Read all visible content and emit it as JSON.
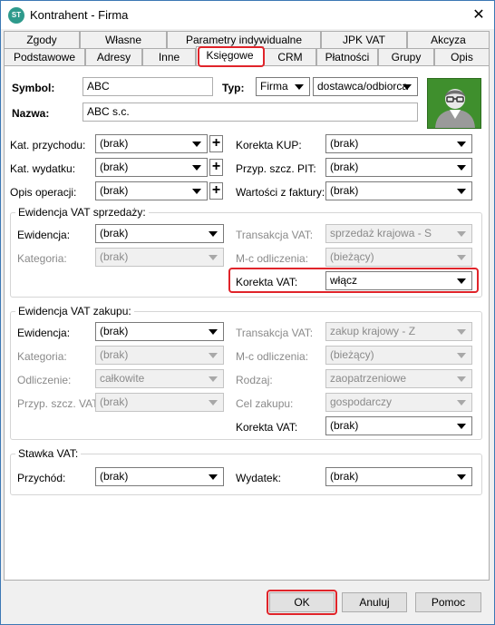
{
  "window": {
    "title": "Kontrahent - Firma",
    "close_glyph": "✕",
    "app_icon_text": "ST"
  },
  "tabs_row1": [
    "Zgody",
    "Własne",
    "Parametry indywidualne",
    "JPK VAT",
    "Akcyza"
  ],
  "tabs_row2": [
    "Podstawowe",
    "Adresy",
    "Inne",
    "Księgowe",
    "CRM",
    "Płatności",
    "Grupy",
    "Opis"
  ],
  "active_tab": "Księgowe",
  "header": {
    "symbol_label": "Symbol:",
    "symbol_value": "ABC",
    "typ_label": "Typ:",
    "typ_value": "Firma",
    "typ2_value": "dostawca/odbiorca",
    "nazwa_label": "Nazwa:",
    "nazwa_value": "ABC s.c."
  },
  "general": {
    "kat_przychodu_label": "Kat. przychodu:",
    "kat_przychodu_value": "(brak)",
    "kat_wydatku_label": "Kat. wydatku:",
    "kat_wydatku_value": "(brak)",
    "opis_operacji_label": "Opis operacji:",
    "opis_operacji_value": "(brak)",
    "korekta_kup_label": "Korekta KUP:",
    "korekta_kup_value": "(brak)",
    "przyp_pit_label": "Przyp. szcz. PIT:",
    "przyp_pit_value": "(brak)",
    "wartosci_label": "Wartości z faktury:",
    "wartosci_value": "(brak)",
    "plus": "+"
  },
  "sprzedaz": {
    "title": "Ewidencja VAT sprzedaży:",
    "ewidencja_label": "Ewidencja:",
    "ewidencja_value": "(brak)",
    "kategoria_label": "Kategoria:",
    "kategoria_value": "(brak)",
    "transakcja_label": "Transakcja VAT:",
    "transakcja_value": "sprzedaż krajowa - S",
    "mc_label": "M-c odliczenia:",
    "mc_value": "(bieżący)",
    "korekta_label": "Korekta VAT:",
    "korekta_value": "włącz"
  },
  "zakup": {
    "title": "Ewidencja VAT zakupu:",
    "ewidencja_label": "Ewidencja:",
    "ewidencja_value": "(brak)",
    "kategoria_label": "Kategoria:",
    "kategoria_value": "(brak)",
    "odliczenie_label": "Odliczenie:",
    "odliczenie_value": "całkowite",
    "przyp_vat_label": "Przyp. szcz. VAT:",
    "przyp_vat_value": "(brak)",
    "transakcja_label": "Transakcja VAT:",
    "transakcja_value": "zakup krajowy - Z",
    "mc_label": "M-c odliczenia:",
    "mc_value": "(bieżący)",
    "rodzaj_label": "Rodzaj:",
    "rodzaj_value": "zaopatrzeniowe",
    "cel_label": "Cel zakupu:",
    "cel_value": "gospodarczy",
    "korekta_label": "Korekta VAT:",
    "korekta_value": "(brak)"
  },
  "stawka": {
    "title": "Stawka VAT:",
    "przychod_label": "Przychód:",
    "przychod_value": "(brak)",
    "wydatek_label": "Wydatek:",
    "wydatek_value": "(brak)"
  },
  "buttons": {
    "ok": "OK",
    "anuluj": "Anuluj",
    "pomoc": "Pomoc"
  },
  "colors": {
    "highlight": "#e0242a",
    "avatar_bg": "#3f8f2d"
  }
}
